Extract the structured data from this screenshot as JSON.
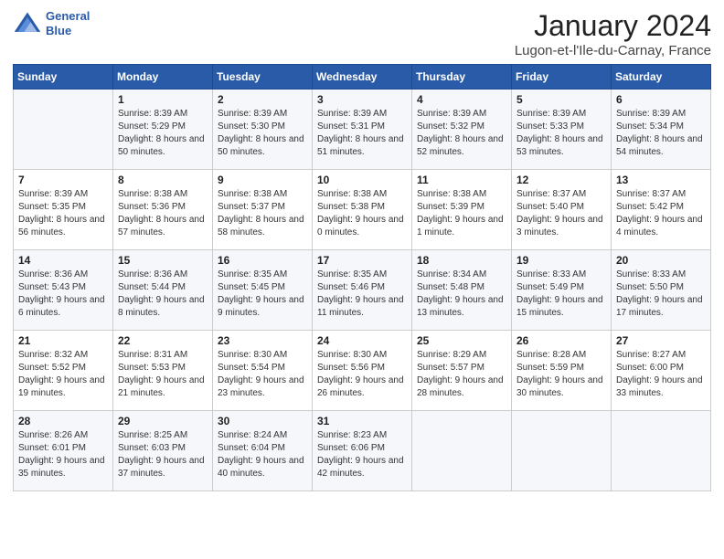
{
  "header": {
    "logo_line1": "General",
    "logo_line2": "Blue",
    "month_title": "January 2024",
    "location": "Lugon-et-l'Ile-du-Carnay, France"
  },
  "columns": [
    "Sunday",
    "Monday",
    "Tuesday",
    "Wednesday",
    "Thursday",
    "Friday",
    "Saturday"
  ],
  "weeks": [
    [
      {
        "day": "",
        "sunrise": "",
        "sunset": "",
        "daylight": ""
      },
      {
        "day": "1",
        "sunrise": "Sunrise: 8:39 AM",
        "sunset": "Sunset: 5:29 PM",
        "daylight": "Daylight: 8 hours and 50 minutes."
      },
      {
        "day": "2",
        "sunrise": "Sunrise: 8:39 AM",
        "sunset": "Sunset: 5:30 PM",
        "daylight": "Daylight: 8 hours and 50 minutes."
      },
      {
        "day": "3",
        "sunrise": "Sunrise: 8:39 AM",
        "sunset": "Sunset: 5:31 PM",
        "daylight": "Daylight: 8 hours and 51 minutes."
      },
      {
        "day": "4",
        "sunrise": "Sunrise: 8:39 AM",
        "sunset": "Sunset: 5:32 PM",
        "daylight": "Daylight: 8 hours and 52 minutes."
      },
      {
        "day": "5",
        "sunrise": "Sunrise: 8:39 AM",
        "sunset": "Sunset: 5:33 PM",
        "daylight": "Daylight: 8 hours and 53 minutes."
      },
      {
        "day": "6",
        "sunrise": "Sunrise: 8:39 AM",
        "sunset": "Sunset: 5:34 PM",
        "daylight": "Daylight: 8 hours and 54 minutes."
      }
    ],
    [
      {
        "day": "7",
        "sunrise": "Sunrise: 8:39 AM",
        "sunset": "Sunset: 5:35 PM",
        "daylight": "Daylight: 8 hours and 56 minutes."
      },
      {
        "day": "8",
        "sunrise": "Sunrise: 8:38 AM",
        "sunset": "Sunset: 5:36 PM",
        "daylight": "Daylight: 8 hours and 57 minutes."
      },
      {
        "day": "9",
        "sunrise": "Sunrise: 8:38 AM",
        "sunset": "Sunset: 5:37 PM",
        "daylight": "Daylight: 8 hours and 58 minutes."
      },
      {
        "day": "10",
        "sunrise": "Sunrise: 8:38 AM",
        "sunset": "Sunset: 5:38 PM",
        "daylight": "Daylight: 9 hours and 0 minutes."
      },
      {
        "day": "11",
        "sunrise": "Sunrise: 8:38 AM",
        "sunset": "Sunset: 5:39 PM",
        "daylight": "Daylight: 9 hours and 1 minute."
      },
      {
        "day": "12",
        "sunrise": "Sunrise: 8:37 AM",
        "sunset": "Sunset: 5:40 PM",
        "daylight": "Daylight: 9 hours and 3 minutes."
      },
      {
        "day": "13",
        "sunrise": "Sunrise: 8:37 AM",
        "sunset": "Sunset: 5:42 PM",
        "daylight": "Daylight: 9 hours and 4 minutes."
      }
    ],
    [
      {
        "day": "14",
        "sunrise": "Sunrise: 8:36 AM",
        "sunset": "Sunset: 5:43 PM",
        "daylight": "Daylight: 9 hours and 6 minutes."
      },
      {
        "day": "15",
        "sunrise": "Sunrise: 8:36 AM",
        "sunset": "Sunset: 5:44 PM",
        "daylight": "Daylight: 9 hours and 8 minutes."
      },
      {
        "day": "16",
        "sunrise": "Sunrise: 8:35 AM",
        "sunset": "Sunset: 5:45 PM",
        "daylight": "Daylight: 9 hours and 9 minutes."
      },
      {
        "day": "17",
        "sunrise": "Sunrise: 8:35 AM",
        "sunset": "Sunset: 5:46 PM",
        "daylight": "Daylight: 9 hours and 11 minutes."
      },
      {
        "day": "18",
        "sunrise": "Sunrise: 8:34 AM",
        "sunset": "Sunset: 5:48 PM",
        "daylight": "Daylight: 9 hours and 13 minutes."
      },
      {
        "day": "19",
        "sunrise": "Sunrise: 8:33 AM",
        "sunset": "Sunset: 5:49 PM",
        "daylight": "Daylight: 9 hours and 15 minutes."
      },
      {
        "day": "20",
        "sunrise": "Sunrise: 8:33 AM",
        "sunset": "Sunset: 5:50 PM",
        "daylight": "Daylight: 9 hours and 17 minutes."
      }
    ],
    [
      {
        "day": "21",
        "sunrise": "Sunrise: 8:32 AM",
        "sunset": "Sunset: 5:52 PM",
        "daylight": "Daylight: 9 hours and 19 minutes."
      },
      {
        "day": "22",
        "sunrise": "Sunrise: 8:31 AM",
        "sunset": "Sunset: 5:53 PM",
        "daylight": "Daylight: 9 hours and 21 minutes."
      },
      {
        "day": "23",
        "sunrise": "Sunrise: 8:30 AM",
        "sunset": "Sunset: 5:54 PM",
        "daylight": "Daylight: 9 hours and 23 minutes."
      },
      {
        "day": "24",
        "sunrise": "Sunrise: 8:30 AM",
        "sunset": "Sunset: 5:56 PM",
        "daylight": "Daylight: 9 hours and 26 minutes."
      },
      {
        "day": "25",
        "sunrise": "Sunrise: 8:29 AM",
        "sunset": "Sunset: 5:57 PM",
        "daylight": "Daylight: 9 hours and 28 minutes."
      },
      {
        "day": "26",
        "sunrise": "Sunrise: 8:28 AM",
        "sunset": "Sunset: 5:59 PM",
        "daylight": "Daylight: 9 hours and 30 minutes."
      },
      {
        "day": "27",
        "sunrise": "Sunrise: 8:27 AM",
        "sunset": "Sunset: 6:00 PM",
        "daylight": "Daylight: 9 hours and 33 minutes."
      }
    ],
    [
      {
        "day": "28",
        "sunrise": "Sunrise: 8:26 AM",
        "sunset": "Sunset: 6:01 PM",
        "daylight": "Daylight: 9 hours and 35 minutes."
      },
      {
        "day": "29",
        "sunrise": "Sunrise: 8:25 AM",
        "sunset": "Sunset: 6:03 PM",
        "daylight": "Daylight: 9 hours and 37 minutes."
      },
      {
        "day": "30",
        "sunrise": "Sunrise: 8:24 AM",
        "sunset": "Sunset: 6:04 PM",
        "daylight": "Daylight: 9 hours and 40 minutes."
      },
      {
        "day": "31",
        "sunrise": "Sunrise: 8:23 AM",
        "sunset": "Sunset: 6:06 PM",
        "daylight": "Daylight: 9 hours and 42 minutes."
      },
      {
        "day": "",
        "sunrise": "",
        "sunset": "",
        "daylight": ""
      },
      {
        "day": "",
        "sunrise": "",
        "sunset": "",
        "daylight": ""
      },
      {
        "day": "",
        "sunrise": "",
        "sunset": "",
        "daylight": ""
      }
    ]
  ]
}
